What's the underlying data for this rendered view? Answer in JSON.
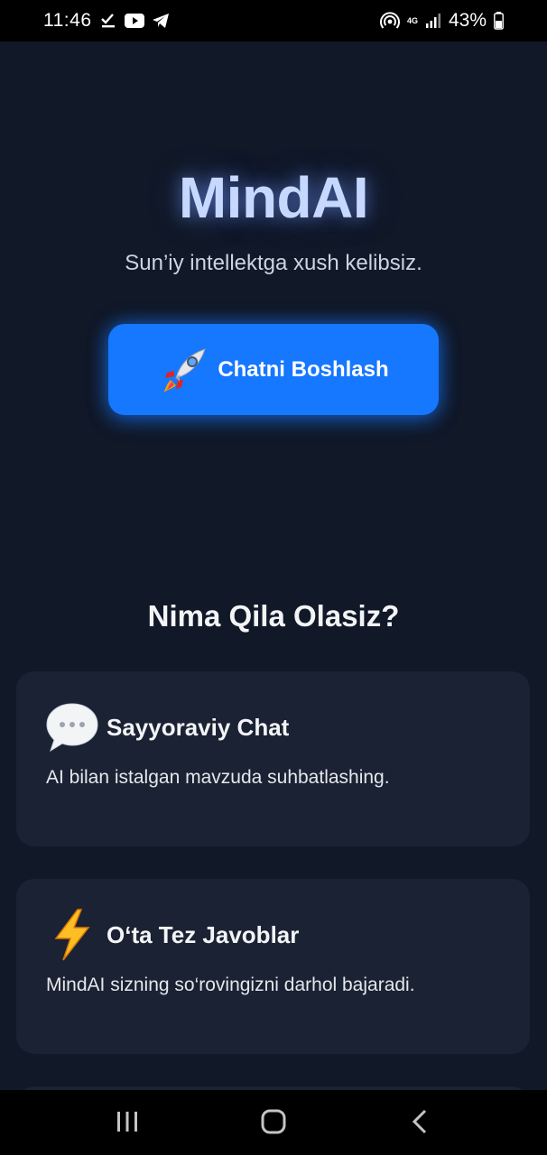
{
  "status_bar": {
    "time": "11:46",
    "network": "4G",
    "battery": "43%",
    "icons": [
      "download-done-icon",
      "youtube-icon",
      "telegram-icon",
      "hotspot-icon",
      "signal-icon",
      "battery-icon"
    ]
  },
  "hero": {
    "title": "MindAI",
    "subtitle": "Sun’iy intellektga xush kelibsiz.",
    "start_button_label": "Chatni Boshlash",
    "start_button_icon": "rocket-icon"
  },
  "features": {
    "title": "Nima Qila Olasiz?",
    "items": [
      {
        "icon": "speech-bubble-icon",
        "title": "Sayyoraviy Chat",
        "desc": "AI bilan istalgan mavzuda suhbatlashing."
      },
      {
        "icon": "lightning-icon",
        "title": "O‘ta Tez Javoblar",
        "desc": "MindAI sizning so‘rovingizni darhol bajaradi."
      }
    ]
  },
  "nav": {
    "buttons": [
      "recent-apps-icon",
      "home-icon",
      "back-icon"
    ]
  },
  "colors": {
    "background": "#111827",
    "card": "#1a2233",
    "accent": "#1677ff",
    "title_glow": "#c7d8ff"
  }
}
